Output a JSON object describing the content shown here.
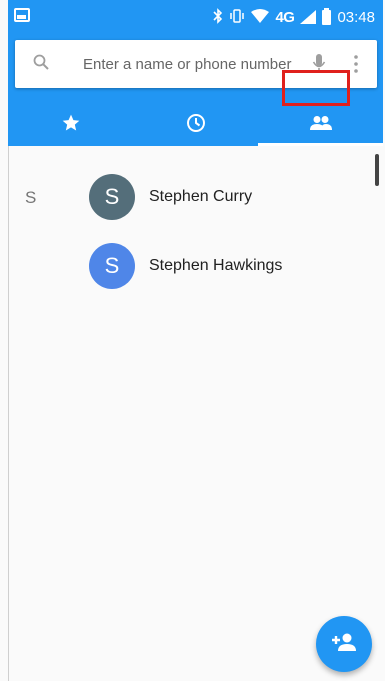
{
  "status_bar": {
    "bluetooth_icon": "bluetooth-icon",
    "vibrate_icon": "vibrate-icon",
    "wifi_icon": "wifi-icon",
    "network_label": "4G",
    "clock": "03:48",
    "colors": {
      "background": "#2196f3"
    }
  },
  "search": {
    "placeholder": "Enter a name or phone number",
    "icons": [
      "search-icon",
      "mic-icon",
      "more-vert-icon"
    ]
  },
  "tabs": [
    {
      "name": "favorites",
      "icon": "star-icon",
      "selected": false
    },
    {
      "name": "recents",
      "icon": "clock-icon",
      "selected": false
    },
    {
      "name": "contacts",
      "icon": "people-icon",
      "selected": true
    }
  ],
  "contacts": {
    "section_letter": "S",
    "items": [
      {
        "initial": "S",
        "name": "Stephen Curry",
        "avatar_color": "#546e7a"
      },
      {
        "initial": "S",
        "name": "Stephen Hawkings",
        "avatar_color": "#4f86e8"
      }
    ]
  },
  "fab": {
    "icon": "add-contact-icon"
  },
  "colors": {
    "accent": "#2196f3",
    "highlight": "#e0201c"
  }
}
